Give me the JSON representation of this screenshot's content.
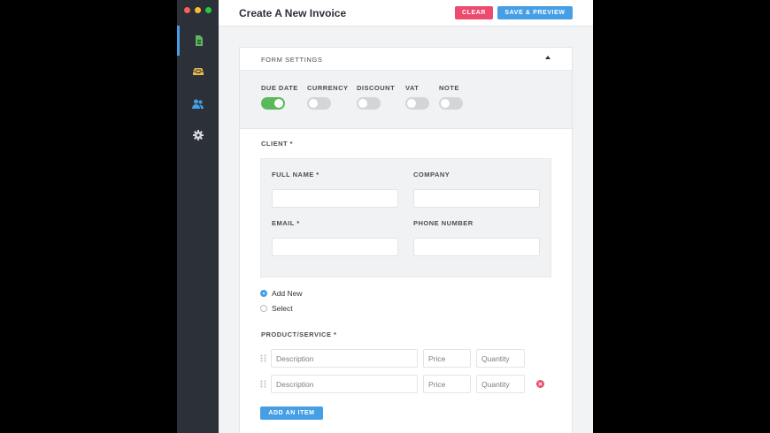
{
  "app": {
    "title": "Create A New Invoice",
    "colors": {
      "accent": "#469fe5",
      "danger": "#ec4b6e",
      "toggle_on": "#5cb85c",
      "sidebar": "#2c3038"
    }
  },
  "window": {
    "traffic_lights": [
      "close-button",
      "minimize-button",
      "zoom-button"
    ]
  },
  "sidebar": {
    "items": [
      {
        "icon": "invoice-icon",
        "active": true
      },
      {
        "icon": "inbox-icon",
        "active": false
      },
      {
        "icon": "contacts-icon",
        "active": false
      },
      {
        "icon": "settings-icon",
        "active": false
      }
    ]
  },
  "toolbar": {
    "clear_label": "CLEAR",
    "save_label": "SAVE & PREVIEW"
  },
  "form_settings": {
    "title": "FORM SETTINGS",
    "toggles": [
      {
        "label": "DUE DATE",
        "on": true
      },
      {
        "label": "CURRENCY",
        "on": false
      },
      {
        "label": "DISCOUNT",
        "on": false
      },
      {
        "label": "VAT",
        "on": false
      },
      {
        "label": "NOTE",
        "on": false
      }
    ]
  },
  "client": {
    "label": "CLIENT *",
    "full_name_label": "FULL NAME *",
    "full_name_value": "",
    "company_label": "COMPANY",
    "company_value": "",
    "email_label": "EMAIL *",
    "email_value": "",
    "phone_label": "PHONE NUMBER",
    "phone_value": "",
    "radio_add_new": "Add New",
    "radio_select": "Select",
    "selected": "Add New"
  },
  "products": {
    "label": "PRODUCT/SERVICE *",
    "rows": [
      {
        "description_placeholder": "Description",
        "price_placeholder": "Price",
        "quantity_placeholder": "Quantity",
        "removable": false
      },
      {
        "description_placeholder": "Description",
        "price_placeholder": "Price",
        "quantity_placeholder": "Quantity",
        "removable": true
      }
    ],
    "add_label": "ADD AN ITEM"
  }
}
